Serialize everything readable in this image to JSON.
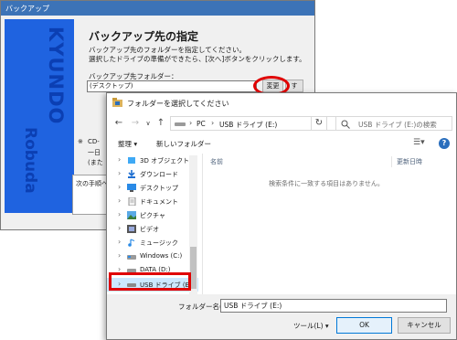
{
  "backup_window": {
    "title": "バックアップ",
    "banner_text": "KYUNDO",
    "banner_text_lower": "Robuda",
    "heading": "バックアップ先の指定",
    "instruction_line1": "バックアップ先のフォルダーを指定してください。",
    "instruction_line2": "選択したドライブの準備ができたら、[次へ]ボタンをクリックします。",
    "dest_label": "バックアップ先フォルダー：",
    "dest_value": "(デスクトップ)",
    "change_button": "変更",
    "partial_button": "す",
    "note_mark": "※",
    "note_line1": "CD-",
    "note_line2": "一日",
    "note_line3": "(また",
    "next_steps": "次の手順へ"
  },
  "folder_dialog": {
    "title": "フォルダーを選択してください",
    "icons": {
      "back": "arrow-left-icon",
      "forward": "arrow-right-icon",
      "recent": "chevron-down-icon",
      "up": "arrow-up-icon",
      "refresh": "refresh-icon",
      "search": "search-icon",
      "help": "help-icon"
    },
    "address": {
      "segments": [
        "PC",
        "USB ドライブ (E:)"
      ]
    },
    "search_placeholder": "USB ドライブ (E:)の検索",
    "toolbar": {
      "organize": "整理 ▾",
      "new_folder": "新しいフォルダー"
    },
    "nav_items": [
      {
        "label": "3D オブジェクト",
        "icon": "cube-icon"
      },
      {
        "label": "ダウンロード",
        "icon": "download-icon"
      },
      {
        "label": "デスクトップ",
        "icon": "desktop-icon"
      },
      {
        "label": "ドキュメント",
        "icon": "document-icon"
      },
      {
        "label": "ピクチャ",
        "icon": "picture-icon"
      },
      {
        "label": "ビデオ",
        "icon": "video-icon"
      },
      {
        "label": "ミュージック",
        "icon": "music-icon"
      },
      {
        "label": "Windows (C:)",
        "icon": "drive-icon"
      },
      {
        "label": "DATA (D:)",
        "icon": "drive-icon"
      },
      {
        "label": "USB ドライブ (E:)",
        "icon": "usb-drive-icon"
      }
    ],
    "columns": {
      "name": "名前",
      "date": "更新日時"
    },
    "empty_message": "検索条件に一致する項目はありません。",
    "folder_name_label": "フォルダー名(N):",
    "folder_name_value": "USB ドライブ (E:)",
    "tools": "ツール(L) ▾",
    "ok": "OK",
    "cancel": "キャンセル"
  },
  "colors": {
    "title_bar": "#3c73b7",
    "banner": "#1f63e0",
    "highlight": "#e00000",
    "ok_border": "#0078d7"
  }
}
